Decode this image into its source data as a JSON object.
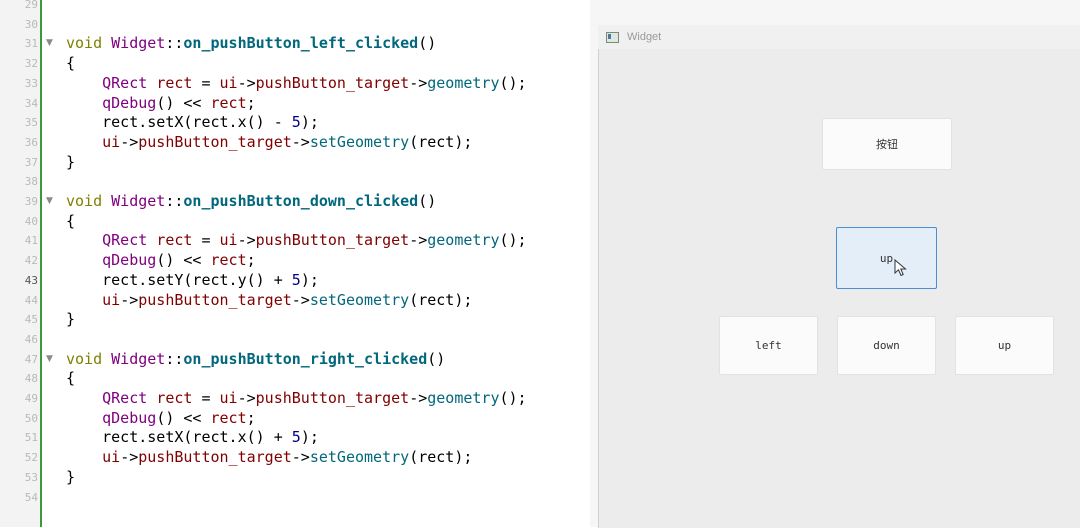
{
  "editor": {
    "line_numbers": [
      "29",
      "30",
      "31",
      "32",
      "33",
      "34",
      "35",
      "36",
      "37",
      "38",
      "39",
      "40",
      "41",
      "42",
      "43",
      "44",
      "45",
      "46",
      "47",
      "48",
      "49",
      "50",
      "51",
      "52",
      "53",
      "54"
    ],
    "current_line": "43",
    "lines": [
      [],
      [],
      [
        {
          "c": "kw",
          "t": "void "
        },
        {
          "c": "cls",
          "t": "Widget"
        },
        {
          "c": "op",
          "t": "::"
        },
        {
          "c": "fn",
          "t": "on_pushButton_left_clicked"
        },
        {
          "c": "op",
          "t": "()"
        }
      ],
      [
        {
          "c": "op",
          "t": "{"
        }
      ],
      [
        {
          "c": "op",
          "t": "    "
        },
        {
          "c": "ty",
          "t": "QRect"
        },
        {
          "c": "op",
          "t": " "
        },
        {
          "c": "mem",
          "t": "rect"
        },
        {
          "c": "op",
          "t": " = "
        },
        {
          "c": "mem",
          "t": "ui"
        },
        {
          "c": "op",
          "t": "->"
        },
        {
          "c": "mem",
          "t": "pushButton_target"
        },
        {
          "c": "op",
          "t": "->"
        },
        {
          "c": "call",
          "t": "geometry"
        },
        {
          "c": "op",
          "t": "();"
        }
      ],
      [
        {
          "c": "op",
          "t": "    "
        },
        {
          "c": "cls",
          "t": "qDebug"
        },
        {
          "c": "op",
          "t": "() << "
        },
        {
          "c": "mem",
          "t": "rect"
        },
        {
          "c": "op",
          "t": ";"
        }
      ],
      [
        {
          "c": "op",
          "t": "    rect.setX(rect.x() - "
        },
        {
          "c": "num",
          "t": "5"
        },
        {
          "c": "op",
          "t": ");"
        }
      ],
      [
        {
          "c": "op",
          "t": "    "
        },
        {
          "c": "mem",
          "t": "ui"
        },
        {
          "c": "op",
          "t": "->"
        },
        {
          "c": "mem",
          "t": "pushButton_target"
        },
        {
          "c": "op",
          "t": "->"
        },
        {
          "c": "call",
          "t": "setGeometry"
        },
        {
          "c": "op",
          "t": "(rect);"
        }
      ],
      [
        {
          "c": "op",
          "t": "}"
        }
      ],
      [],
      [
        {
          "c": "kw",
          "t": "void "
        },
        {
          "c": "cls",
          "t": "Widget"
        },
        {
          "c": "op",
          "t": "::"
        },
        {
          "c": "fn",
          "t": "on_pushButton_down_clicked"
        },
        {
          "c": "op",
          "t": "()"
        }
      ],
      [
        {
          "c": "op",
          "t": "{"
        }
      ],
      [
        {
          "c": "op",
          "t": "    "
        },
        {
          "c": "ty",
          "t": "QRect"
        },
        {
          "c": "op",
          "t": " "
        },
        {
          "c": "mem",
          "t": "rect"
        },
        {
          "c": "op",
          "t": " = "
        },
        {
          "c": "mem",
          "t": "ui"
        },
        {
          "c": "op",
          "t": "->"
        },
        {
          "c": "mem",
          "t": "pushButton_target"
        },
        {
          "c": "op",
          "t": "->"
        },
        {
          "c": "call",
          "t": "geometry"
        },
        {
          "c": "op",
          "t": "();"
        }
      ],
      [
        {
          "c": "op",
          "t": "    "
        },
        {
          "c": "cls",
          "t": "qDebug"
        },
        {
          "c": "op",
          "t": "() << "
        },
        {
          "c": "mem",
          "t": "rect"
        },
        {
          "c": "op",
          "t": ";"
        }
      ],
      [
        {
          "c": "op",
          "t": "    rect.setY(rect.y() + "
        },
        {
          "c": "num",
          "t": "5"
        },
        {
          "c": "op",
          "t": ");"
        }
      ],
      [
        {
          "c": "op",
          "t": "    "
        },
        {
          "c": "mem",
          "t": "ui"
        },
        {
          "c": "op",
          "t": "->"
        },
        {
          "c": "mem",
          "t": "pushButton_target"
        },
        {
          "c": "op",
          "t": "->"
        },
        {
          "c": "call",
          "t": "setGeometry"
        },
        {
          "c": "op",
          "t": "(rect);"
        }
      ],
      [
        {
          "c": "op",
          "t": "}"
        }
      ],
      [],
      [
        {
          "c": "kw",
          "t": "void "
        },
        {
          "c": "cls",
          "t": "Widget"
        },
        {
          "c": "op",
          "t": "::"
        },
        {
          "c": "fn",
          "t": "on_pushButton_right_clicked"
        },
        {
          "c": "op",
          "t": "()"
        }
      ],
      [
        {
          "c": "op",
          "t": "{"
        }
      ],
      [
        {
          "c": "op",
          "t": "    "
        },
        {
          "c": "ty",
          "t": "QRect"
        },
        {
          "c": "op",
          "t": " "
        },
        {
          "c": "mem",
          "t": "rect"
        },
        {
          "c": "op",
          "t": " = "
        },
        {
          "c": "mem",
          "t": "ui"
        },
        {
          "c": "op",
          "t": "->"
        },
        {
          "c": "mem",
          "t": "pushButton_target"
        },
        {
          "c": "op",
          "t": "->"
        },
        {
          "c": "call",
          "t": "geometry"
        },
        {
          "c": "op",
          "t": "();"
        }
      ],
      [
        {
          "c": "op",
          "t": "    "
        },
        {
          "c": "cls",
          "t": "qDebug"
        },
        {
          "c": "op",
          "t": "() << "
        },
        {
          "c": "mem",
          "t": "rect"
        },
        {
          "c": "op",
          "t": ";"
        }
      ],
      [
        {
          "c": "op",
          "t": "    rect.setX(rect.x() + "
        },
        {
          "c": "num",
          "t": "5"
        },
        {
          "c": "op",
          "t": ");"
        }
      ],
      [
        {
          "c": "op",
          "t": "    "
        },
        {
          "c": "mem",
          "t": "ui"
        },
        {
          "c": "op",
          "t": "->"
        },
        {
          "c": "mem",
          "t": "pushButton_target"
        },
        {
          "c": "op",
          "t": "->"
        },
        {
          "c": "call",
          "t": "setGeometry"
        },
        {
          "c": "op",
          "t": "(rect);"
        }
      ],
      [
        {
          "c": "op",
          "t": "}"
        }
      ],
      []
    ],
    "fold_markers": [
      "31",
      "39",
      "47"
    ]
  },
  "window": {
    "title": "Widget",
    "buttons": {
      "target": "按钮",
      "up_top": "up",
      "left": "left",
      "down": "down",
      "up_right": "up"
    },
    "hovered": "up_top"
  },
  "colors": {
    "gutter_accent": "#3a9a3a",
    "hover_border": "#4a8fd1",
    "keyword": "#808000",
    "class": "#800080",
    "function_def": "#00677c"
  }
}
